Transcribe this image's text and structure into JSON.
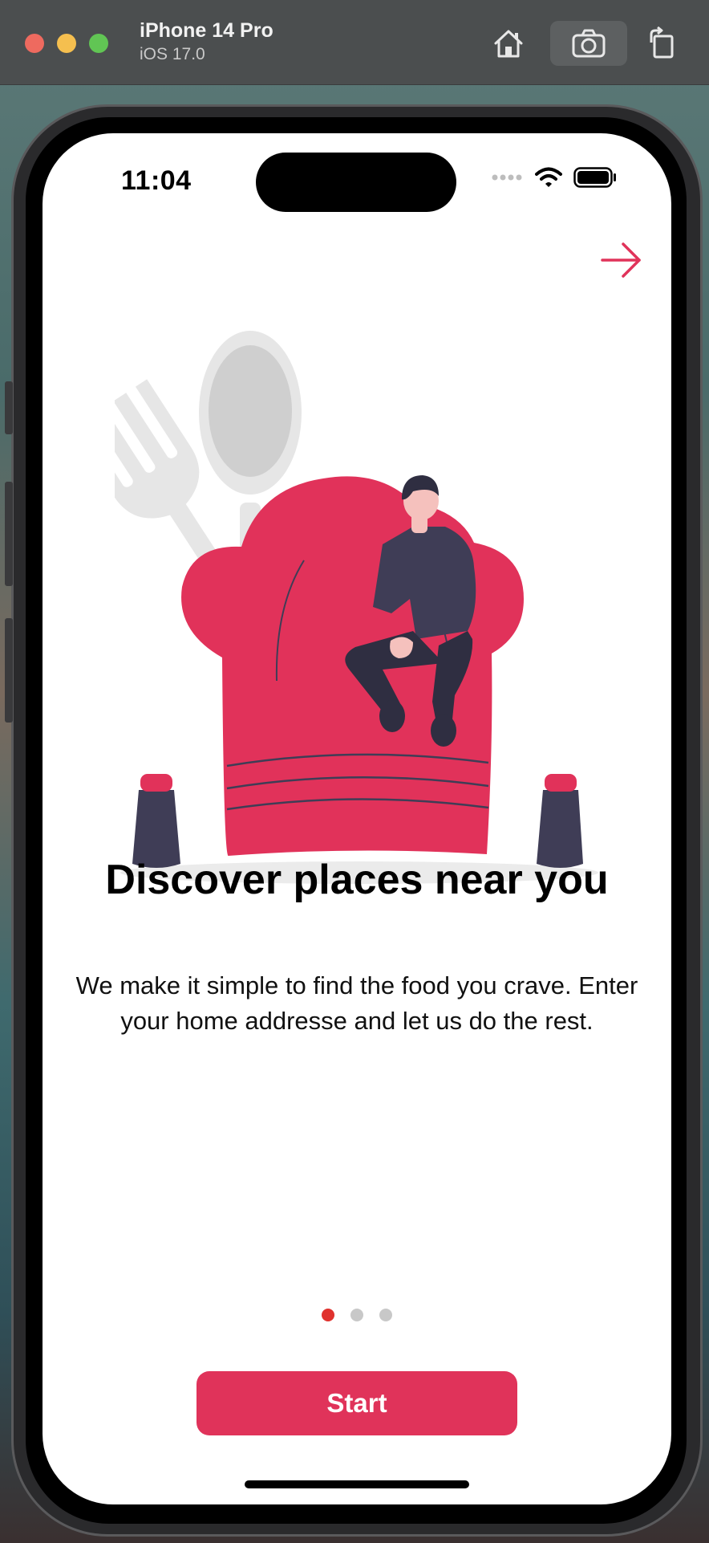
{
  "simulator": {
    "device_name": "iPhone 14 Pro",
    "os_version": "iOS 17.0",
    "toolbar_icons": [
      "home-icon",
      "screenshot-icon",
      "rotate-icon"
    ]
  },
  "status_bar": {
    "time": "11:04",
    "icons": [
      "signal-dots-icon",
      "wifi-icon",
      "battery-icon"
    ]
  },
  "onboarding": {
    "next_icon": "arrow-right-icon",
    "illustration": "chef-hat-illustration",
    "title": "Discover places near you",
    "description": "We make it simple to find the food you crave. Enter your  home addresse and let us do the rest.",
    "page_count": 3,
    "current_page": 1,
    "start_label": "Start"
  },
  "colors": {
    "accent": "#e0335a",
    "active_dot": "#e0322e",
    "inactive_dot": "#c8c8c8",
    "figure_dark": "#3f3d56"
  }
}
